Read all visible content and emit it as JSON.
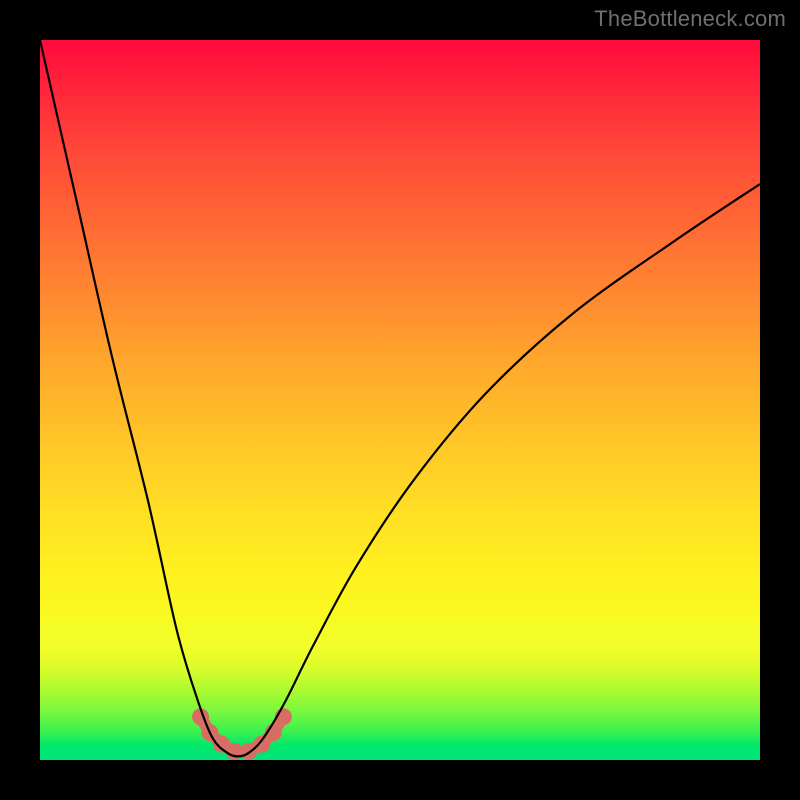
{
  "watermark": {
    "text": "TheBottleneck.com"
  },
  "chart_data": {
    "type": "line",
    "title": "",
    "xlabel": "",
    "ylabel": "",
    "xlim": [
      0,
      100
    ],
    "ylim": [
      0,
      100
    ],
    "grid": false,
    "series": [
      {
        "name": "bottleneck-curve",
        "x": [
          0,
          5,
          10,
          15,
          19,
          22,
          24,
          26,
          27.5,
          29,
          31,
          34,
          38,
          44,
          52,
          62,
          74,
          88,
          100
        ],
        "values": [
          100,
          78,
          56,
          36,
          18,
          8,
          3,
          1,
          0.5,
          1,
          3,
          8,
          16,
          27,
          39,
          51,
          62,
          72,
          80
        ]
      }
    ],
    "annotations": {
      "markers": {
        "name": "trough-markers",
        "color": "#d86e63",
        "points": [
          {
            "x": 22.3,
            "y": 6.0
          },
          {
            "x": 23.6,
            "y": 3.8
          },
          {
            "x": 25.2,
            "y": 2.2
          },
          {
            "x": 27.0,
            "y": 1.2
          },
          {
            "x": 29.0,
            "y": 1.2
          },
          {
            "x": 30.8,
            "y": 2.2
          },
          {
            "x": 32.4,
            "y": 3.8
          },
          {
            "x": 33.8,
            "y": 6.0
          }
        ],
        "connector_width": 12
      }
    },
    "background": {
      "type": "vertical-gradient",
      "stops": [
        {
          "pos": 0,
          "color": "#ff0a3c"
        },
        {
          "pos": 26,
          "color": "#ff6a34"
        },
        {
          "pos": 56,
          "color": "#ffc628"
        },
        {
          "pos": 80,
          "color": "#f8fa20"
        },
        {
          "pos": 93,
          "color": "#7ef73c"
        },
        {
          "pos": 100,
          "color": "#00e37a"
        }
      ]
    }
  }
}
